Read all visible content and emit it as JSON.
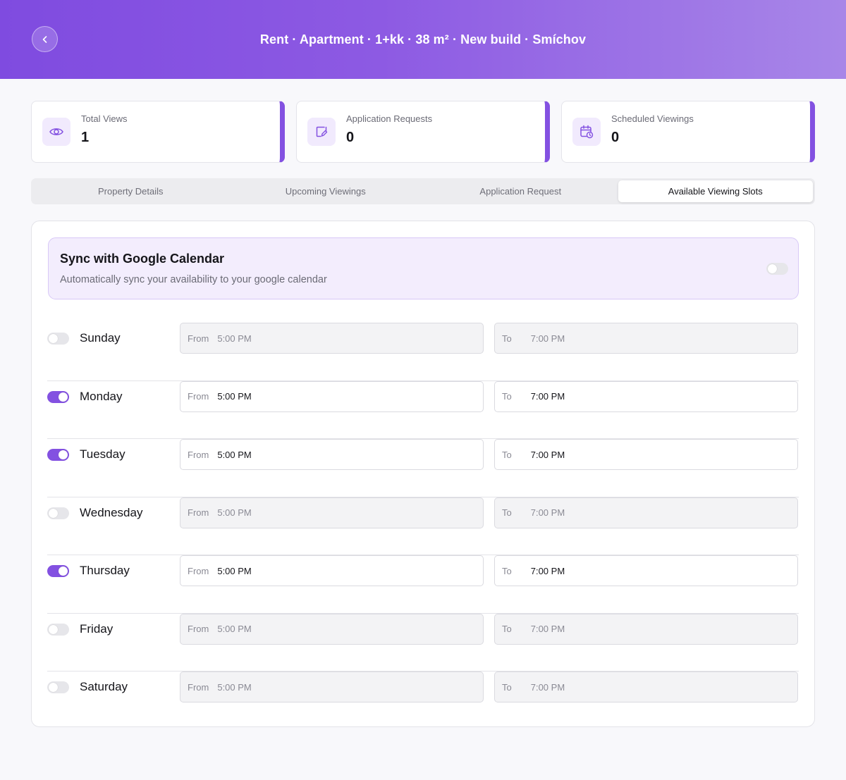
{
  "header": {
    "title": "Rent · Apartment · 1+kk · 38 m² · New build · Smíchov"
  },
  "stats": [
    {
      "label": "Total Views",
      "value": "1",
      "icon": "eye-icon"
    },
    {
      "label": "Application Requests",
      "value": "0",
      "icon": "note-edit-icon"
    },
    {
      "label": "Scheduled Viewings",
      "value": "0",
      "icon": "calendar-clock-icon"
    }
  ],
  "tabs": [
    {
      "label": "Property Details",
      "active": false
    },
    {
      "label": "Upcoming Viewings",
      "active": false
    },
    {
      "label": "Application Request",
      "active": false
    },
    {
      "label": "Available Viewing Slots",
      "active": true
    }
  ],
  "sync": {
    "title": "Sync with Google Calendar",
    "subtitle": "Automatically sync your availability to your google calendar",
    "enabled": false
  },
  "field_labels": {
    "from": "From",
    "to": "To"
  },
  "days": [
    {
      "name": "Sunday",
      "enabled": false,
      "from": "5:00 PM",
      "to": "7:00 PM"
    },
    {
      "name": "Monday",
      "enabled": true,
      "from": "5:00 PM",
      "to": "7:00 PM"
    },
    {
      "name": "Tuesday",
      "enabled": true,
      "from": "5:00 PM",
      "to": "7:00 PM"
    },
    {
      "name": "Wednesday",
      "enabled": false,
      "from": "5:00 PM",
      "to": "7:00 PM"
    },
    {
      "name": "Thursday",
      "enabled": true,
      "from": "5:00 PM",
      "to": "7:00 PM"
    },
    {
      "name": "Friday",
      "enabled": false,
      "from": "5:00 PM",
      "to": "7:00 PM"
    },
    {
      "name": "Saturday",
      "enabled": false,
      "from": "5:00 PM",
      "to": "7:00 PM"
    }
  ],
  "colors": {
    "accent": "#8351e1",
    "header_start": "#7f4be0",
    "header_end": "#a886e8"
  }
}
